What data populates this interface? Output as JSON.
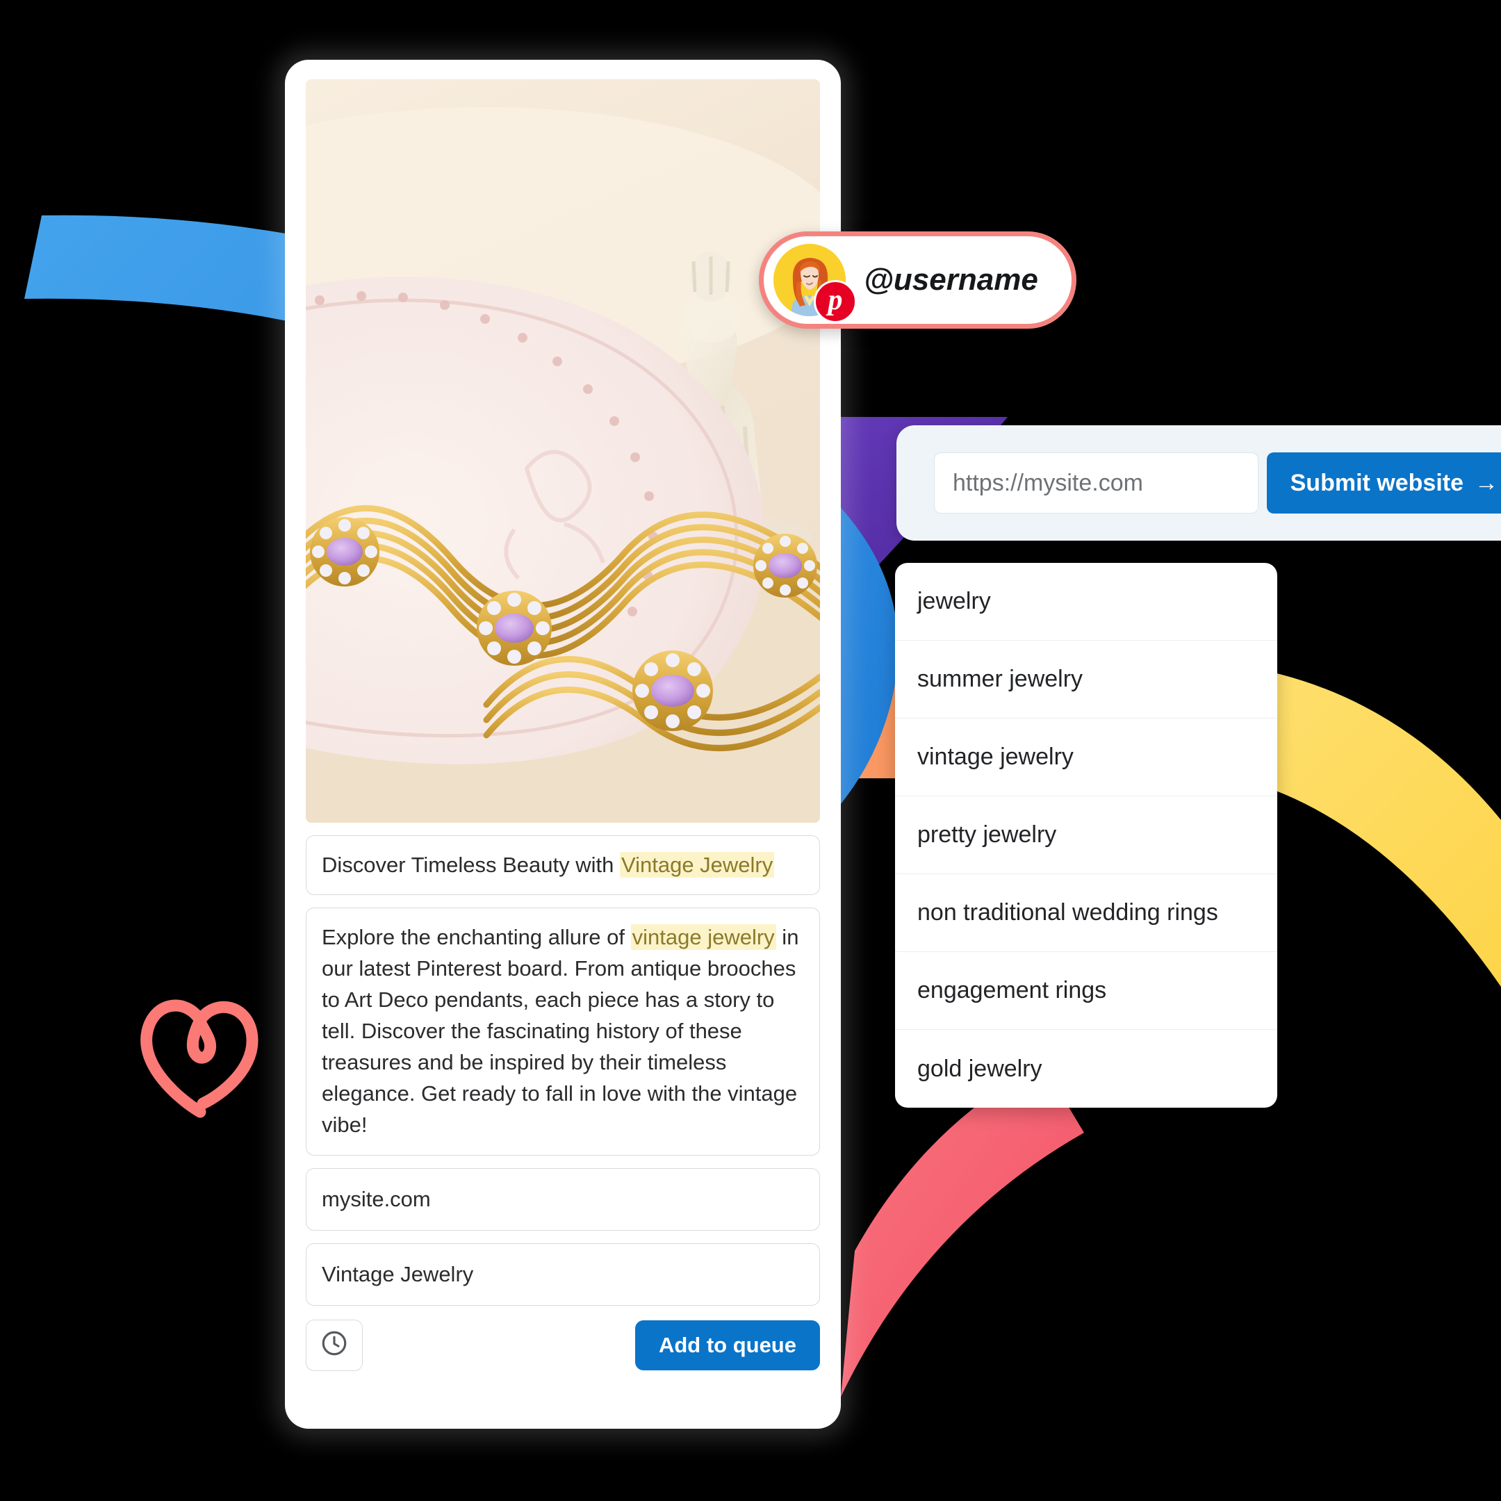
{
  "badge": {
    "username": "@username",
    "avatar_icon": "user-avatar-photo",
    "platform_icon": "pinterest-logo-icon",
    "border_color": "#f4837f",
    "avatar_bg": "#FAD02C",
    "pinterest_red": "#E60023"
  },
  "submit_panel": {
    "url_placeholder": "https://mysite.com",
    "submit_label": "Submit website",
    "arrow_glyph": "→",
    "button_color": "#0a74c9",
    "panel_bg": "#eff4f9"
  },
  "keywords": {
    "items": [
      "jewelry",
      "summer jewelry",
      "vintage jewelry",
      "pretty jewelry",
      "non traditional wedding rings",
      "engagement rings",
      "gold jewelry"
    ]
  },
  "pin_composer": {
    "image_alt": "gold necklace with purple amethyst gemstones on a pink scalloped plate",
    "title": {
      "plain_before": "Discover Timeless Beauty with ",
      "highlight": "Vintage Jewelry",
      "full": "Discover Timeless Beauty with Vintage Jewelry"
    },
    "description": {
      "plain_before": "Explore the enchanting allure of ",
      "highlight": "vintage jewelry",
      "plain_after": " in our latest Pinterest board. From antique brooches to Art Deco pendants, each piece has a story to tell. Discover the fascinating history of these treasures and be inspired by their timeless elegance. Get ready to fall in love with the vintage vibe!",
      "full": "Explore the enchanting allure of vintage jewelry in our latest Pinterest board. From antique brooches to Art Deco pendants, each piece has a story to tell. Discover the fascinating history of these treasures and be inspired by their timeless elegance. Get ready to fall in love with the vintage vibe!"
    },
    "destination_url": "mysite.com",
    "board_name": "Vintage Jewelry",
    "schedule_icon": "clock-icon",
    "queue_label": "Add to queue",
    "highlight_bg": "#fcf3c9",
    "highlight_text": "#8a7a2a"
  },
  "decoration": {
    "heart_icon": "heart-doodle-icon",
    "heart_color": "#FB7A76",
    "ribbon_colors": {
      "blue_light": "#3E9BE8",
      "blue_dark": "#1877D2",
      "purple": "#5A2EA6",
      "orange": "#F79356",
      "yellow": "#FFDC5C",
      "pink": "#F5606E"
    }
  }
}
